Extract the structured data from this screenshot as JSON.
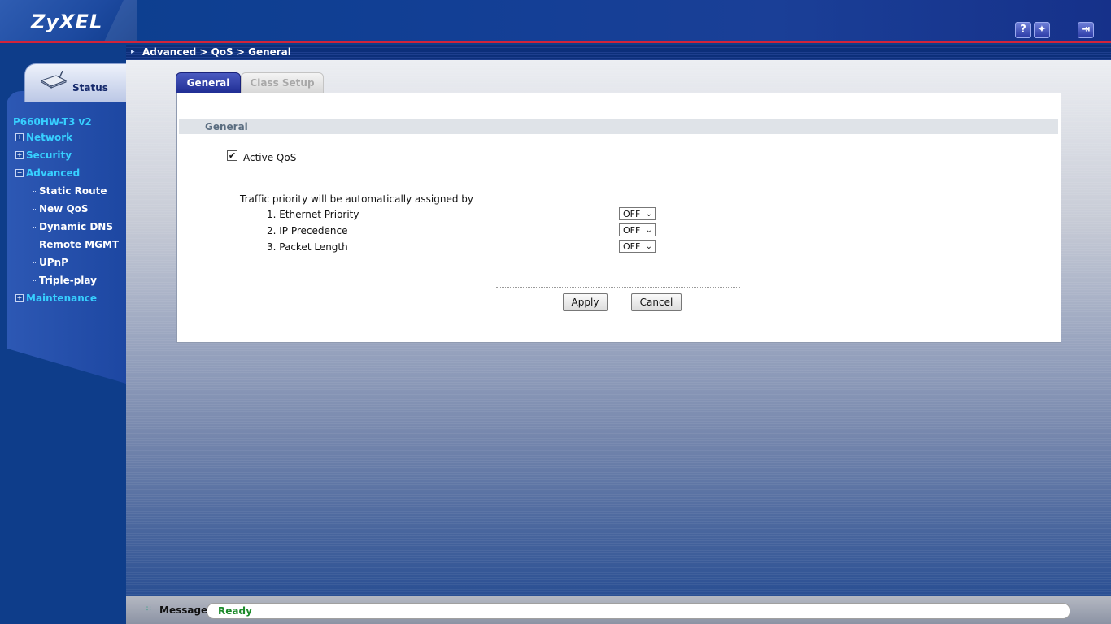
{
  "header": {
    "logo": "ZyXEL",
    "icons": [
      "help-icon",
      "wizard-icon",
      "logout-icon"
    ]
  },
  "breadcrumb": "Advanced > QoS > General",
  "sidebar": {
    "status_label": "Status",
    "model": "P660HW-T3 v2",
    "items": [
      {
        "label": "Network",
        "toggle": "+"
      },
      {
        "label": "Security",
        "toggle": "+"
      },
      {
        "label": "Advanced",
        "toggle": "−"
      },
      {
        "label": "Maintenance",
        "toggle": "+"
      }
    ],
    "advanced_children": [
      "Static Route",
      "New QoS",
      "Dynamic DNS",
      "Remote MGMT",
      "UPnP",
      "Triple-play"
    ]
  },
  "tabs": [
    "General",
    "Class Setup"
  ],
  "section_title": "General",
  "active_qos": {
    "label": "Active QoS",
    "checked": true
  },
  "priority": {
    "intro": "Traffic priority will be automatically assigned by",
    "rows": [
      {
        "label": "1. Ethernet Priority",
        "value": "OFF"
      },
      {
        "label": "2. IP Precedence",
        "value": "OFF"
      },
      {
        "label": "3. Packet Length",
        "value": "OFF"
      }
    ]
  },
  "buttons": {
    "apply": "Apply",
    "cancel": "Cancel"
  },
  "footer": {
    "message_label": "Message",
    "message_value": "Ready"
  }
}
